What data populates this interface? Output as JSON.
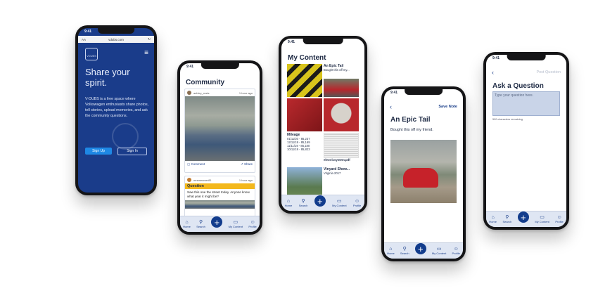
{
  "phone1": {
    "time": "9:41",
    "url": "vdubs.com",
    "aa": "AA",
    "logo_text": "VDUBS",
    "headline": "Share your spirit.",
    "body": "V-DUBS is a free space where Volkswagen enthusiasts share photos, tell stories, upload memories, and ask the community questions.",
    "signup": "Sign Up",
    "signin": "Sign In"
  },
  "phone2": {
    "time": "9:41",
    "title": "Community",
    "post1": {
      "user": "ashley_rusts",
      "time": "1 hour ago",
      "comments": "Comment",
      "share": "Share"
    },
    "post2": {
      "user": "mrsmesmer81",
      "time": "1 hour ago",
      "tag": "Question",
      "text": "Saw this one the street today. Anyone know what year it might be?"
    }
  },
  "phone3": {
    "time": "9:41",
    "title": "My Content",
    "cells": [
      {
        "heading": "An Epic Tail",
        "sub": "Bought this off my..."
      },
      {
        "heading": "Mileage",
        "lines": [
          "01/11/20 - 85,237",
          "12/11/19 - 85,169",
          "11/11/19 - 85,180",
          "10/11/19 - 85,823"
        ]
      },
      {
        "heading": "electricsystem.pdf"
      },
      {
        "heading": "Vinyard Show...",
        "sub": "Virginia 2017"
      }
    ]
  },
  "phone4": {
    "time": "9:41",
    "save": "Save Note",
    "title": "An Epic Tail",
    "subtitle": "Bought this off my friend."
  },
  "phone5": {
    "time": "9:41",
    "post": "Post Question",
    "title": "Ask a Question",
    "placeholder": "Type your question here.",
    "remaining": "500 characters remaining"
  },
  "tabbar": {
    "home": "Home",
    "search": "Search",
    "content": "My Content",
    "profile": "Profile"
  }
}
